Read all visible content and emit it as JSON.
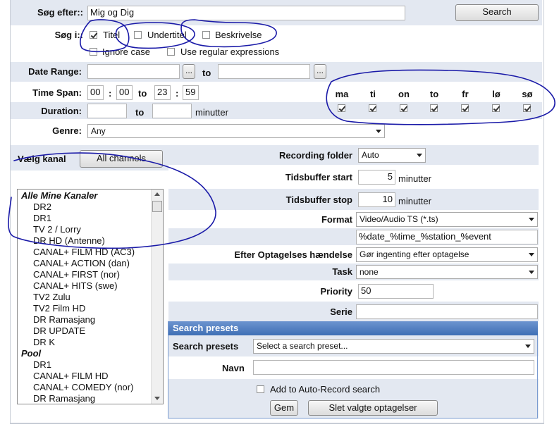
{
  "search": {
    "label": "Søg efter::",
    "value": "Mig og Dig",
    "button": "Search"
  },
  "search_in": {
    "label": "Søg i::",
    "options": [
      {
        "label": "Titel",
        "checked": true
      },
      {
        "label": "Undertitel",
        "checked": false
      },
      {
        "label": "Beskrivelse",
        "checked": false
      }
    ],
    "ignore_case": {
      "label": "Ignore case",
      "checked": false
    },
    "regex": {
      "label": "Use regular expressions",
      "checked": false
    }
  },
  "date_range": {
    "label": "Date Range:",
    "to": "to",
    "picker": "..."
  },
  "time_span": {
    "label": "Time Span:",
    "from_h": "00",
    "from_m": "00",
    "to": "to",
    "to_h": "23",
    "to_m": "59",
    "sep": ":"
  },
  "days": [
    {
      "label": "ma",
      "checked": true
    },
    {
      "label": "ti",
      "checked": true
    },
    {
      "label": "on",
      "checked": true
    },
    {
      "label": "to",
      "checked": true
    },
    {
      "label": "fr",
      "checked": true
    },
    {
      "label": "lø",
      "checked": true
    },
    {
      "label": "sø",
      "checked": true
    }
  ],
  "duration": {
    "label": "Duration:",
    "to": "to",
    "unit": "minutter"
  },
  "genre": {
    "label": "Genre:",
    "value": "Any"
  },
  "channels": {
    "label": "Vælg kanal",
    "button": "All channels",
    "groups": [
      {
        "name": "Alle Mine Kanaler",
        "items": [
          "DR2",
          "DR1",
          "TV 2 / Lorry",
          "DR HD (Antenne)",
          "CANAL+ FILM HD (AC3)",
          "CANAL+ ACTION (dan)",
          "CANAL+ FIRST (nor)",
          "CANAL+ HITS (swe)",
          "TV2 Zulu",
          "TV2 Film HD",
          "DR Ramasjang",
          "DR UPDATE",
          "DR K"
        ]
      },
      {
        "name": "Pool",
        "items": [
          "DR1",
          "CANAL+ FILM HD",
          "CANAL+ COMEDY (nor)",
          "DR Ramasjang"
        ]
      }
    ]
  },
  "recording": {
    "folder_label": "Recording folder",
    "folder_value": "Auto",
    "buffer_start_label": "Tidsbuffer start",
    "buffer_start_value": "5",
    "buffer_stop_label": "Tidsbuffer stop",
    "buffer_stop_value": "10",
    "minutes": "minutter",
    "format_label": "Format",
    "format_value": "Video/Audio TS (*.ts)",
    "filename_pattern": "%date_%time_%station_%event",
    "after_label": "Efter Optagelses hændelse",
    "after_value": "Gør ingenting efter optagelse",
    "task_label": "Task",
    "task_value": "none",
    "priority_label": "Priority",
    "priority_value": "50",
    "serie_label": "Serie",
    "serie_value": ""
  },
  "presets": {
    "header": "Search presets",
    "label": "Search presets",
    "select_value": "Select a search preset...",
    "name_label": "Navn",
    "auto_record": {
      "label": "Add to Auto-Record search",
      "checked": false
    },
    "save_button": "Gem",
    "delete_button": "Slet valgte optagelser"
  },
  "colors": {
    "band": "#e3e8f1",
    "annotation": "#1a1aa8",
    "header": "#3f6fb5"
  }
}
